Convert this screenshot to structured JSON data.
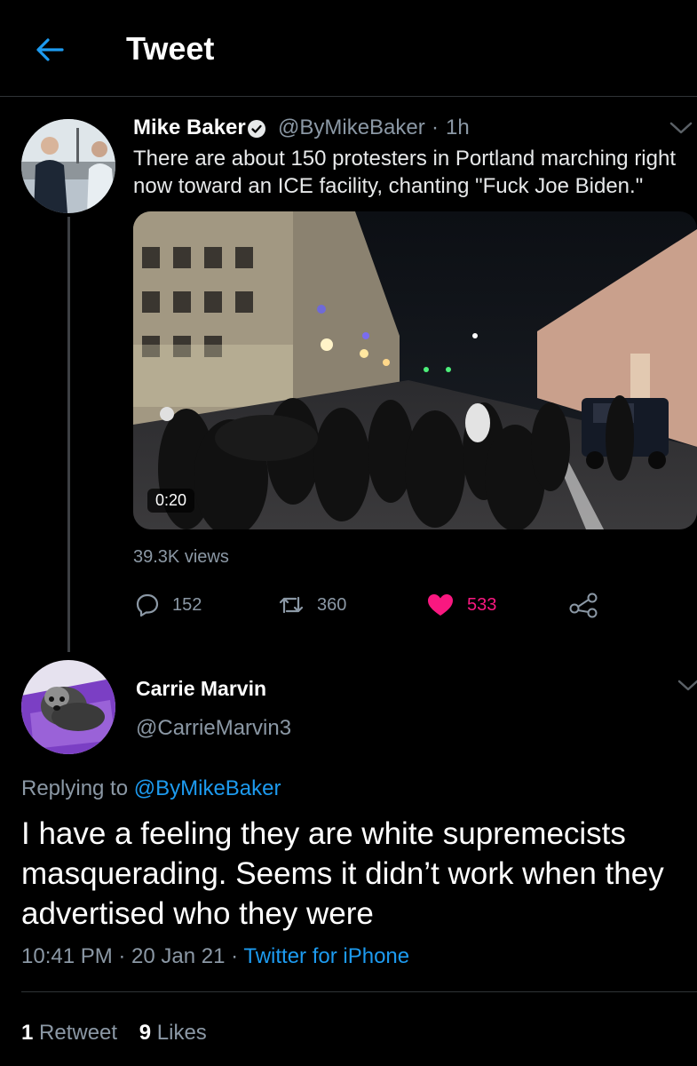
{
  "header": {
    "title": "Tweet",
    "back_icon": "arrow-left-icon"
  },
  "tweet": {
    "author_name": "Mike Baker",
    "verified": true,
    "handle": "@ByMikeBaker",
    "separator": "·",
    "time": "1h",
    "text": "There are about 150 protesters in Portland marching right now toward an ICE facility, chanting \"Fuck Joe Biden.\"",
    "media": {
      "type": "video",
      "duration": "0:20"
    },
    "views": "39.3K views",
    "actions": {
      "reply_count": "152",
      "retweet_count": "360",
      "like_count": "533",
      "liked": true
    }
  },
  "reply": {
    "author_name": "Carrie Marvin",
    "handle": "@CarrieMarvin3",
    "replying_prefix": "Replying to",
    "replying_to": "@ByMikeBaker",
    "text": "I have a feeling they are white supremecists masquerading. Seems it didn’t work when they advertised who they were",
    "timestamp": "10:41 PM · 20 Jan 21 ·",
    "source": "Twitter for iPhone",
    "retweets_count": "1",
    "retweets_label": "Retweet",
    "likes_count": "9",
    "likes_label": "Likes"
  },
  "colors": {
    "background": "#000000",
    "accent": "#1d9bf0",
    "like": "#f91880",
    "muted": "#8b98a5"
  }
}
